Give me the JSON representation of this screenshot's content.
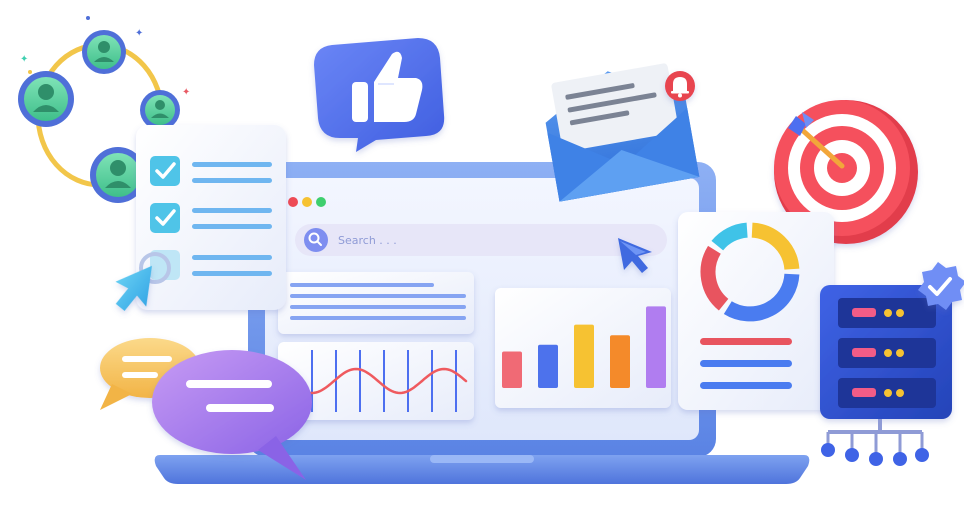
{
  "search": {
    "placeholder": "Search . . ."
  },
  "window_dots": [
    "red",
    "yellow",
    "green"
  ],
  "icons": {
    "team_network": "people-network-icon",
    "checklist": "checklist-icon",
    "like": "thumbs-up-icon",
    "mail": "envelope-icon",
    "notification": "bell-icon",
    "target": "target-icon",
    "donut": "donut-chart-icon",
    "server": "server-rack-icon",
    "verified": "verified-badge-icon",
    "chat": "chat-bubbles-icon",
    "cursor": "cursor-icon"
  },
  "colors": {
    "laptop": "#6f95ea",
    "screen": "#e9effd",
    "accent_blue": "#4d6ff0",
    "red": "#e85a64",
    "yellow": "#f6c232",
    "green": "#3fcf8e",
    "purple": "#9b7cf2",
    "orange": "#f48a2a"
  },
  "bar_chart": {
    "values": [
      38,
      45,
      66,
      55,
      85
    ],
    "colors": [
      "#f06a75",
      "#4d72ec",
      "#f6c232",
      "#f48a2a",
      "#b07df0"
    ]
  },
  "donut": {
    "segments": [
      {
        "color": "#f6c232",
        "value": 25
      },
      {
        "color": "#4a7cf0",
        "value": 35
      },
      {
        "color": "#e8545f",
        "value": 25
      },
      {
        "color": "#3fc3e8",
        "value": 15
      }
    ]
  }
}
